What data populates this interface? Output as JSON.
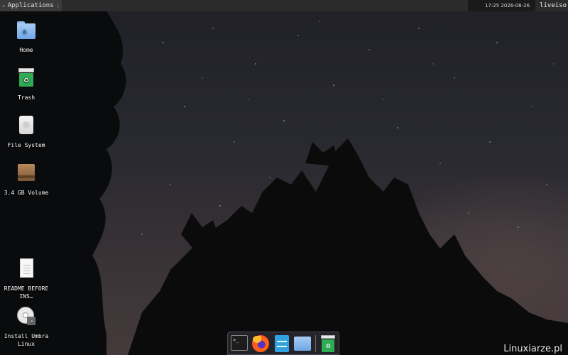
{
  "panel": {
    "apps_label": "Applications",
    "clock": "17:25 2026-08-26",
    "user": "liveiso"
  },
  "desktop": {
    "icons": [
      {
        "label": "Home",
        "icon": "home-folder-icon"
      },
      {
        "label": "Trash",
        "icon": "trash-icon"
      },
      {
        "label": "File System",
        "icon": "drive-icon"
      },
      {
        "label": "3.4 GB Volume",
        "icon": "volume-icon"
      },
      {
        "label": "README BEFORE INS…",
        "icon": "document-icon"
      },
      {
        "label": "Install Umbra Linux",
        "icon": "installer-icon"
      }
    ]
  },
  "dock": {
    "items": [
      "terminal-icon",
      "firefox-icon",
      "file-cabinet-icon",
      "folder-icon",
      "trash-icon"
    ]
  },
  "watermark": "Linuxiarze.pl",
  "colors": {
    "panel_bg": "#2b2b2b",
    "folder": "#6ea6e6",
    "trash": "#2faa55"
  }
}
